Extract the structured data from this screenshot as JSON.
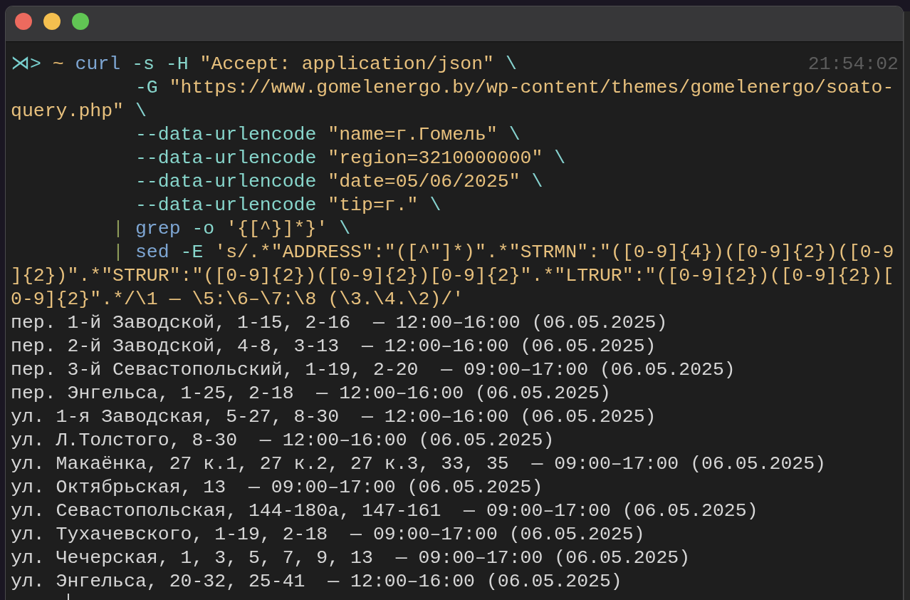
{
  "window": {
    "controls": [
      {
        "kind": "close"
      },
      {
        "kind": "minimize"
      },
      {
        "kind": "zoom"
      }
    ]
  },
  "terminal": {
    "command_lines": [
      {
        "kind": "first",
        "timestamp": "21:54:02",
        "segments": [
          {
            "kind": "prompt",
            "text": "⋊>"
          },
          {
            "kind": "path",
            "text": " ~"
          },
          {
            "kind": "command",
            "text": " curl"
          },
          {
            "kind": "flag",
            "text": " -s -H"
          },
          {
            "kind": "string",
            "text": " \"Accept: application/json\""
          },
          {
            "kind": "continuation",
            "text": " \\"
          }
        ]
      },
      {
        "kind": "argument",
        "segments": [
          {
            "kind": "flag",
            "text": "-G"
          },
          {
            "kind": "string",
            "text": " \"https://www.gomelenergo.by/wp-content/themes/gomelenergo/soato-"
          }
        ]
      },
      {
        "kind": "wrap",
        "segments": [
          {
            "kind": "string",
            "text": "query.php\""
          },
          {
            "kind": "continuation",
            "text": " \\"
          }
        ]
      },
      {
        "kind": "argument",
        "segments": [
          {
            "kind": "flag",
            "text": "--data-urlencode"
          },
          {
            "kind": "string",
            "text": " \"name=г.Гомель\""
          },
          {
            "kind": "continuation",
            "text": " \\"
          }
        ]
      },
      {
        "kind": "argument",
        "segments": [
          {
            "kind": "flag",
            "text": "--data-urlencode"
          },
          {
            "kind": "string",
            "text": " \"region=3210000000\""
          },
          {
            "kind": "continuation",
            "text": " \\"
          }
        ]
      },
      {
        "kind": "argument",
        "segments": [
          {
            "kind": "flag",
            "text": "--data-urlencode"
          },
          {
            "kind": "string",
            "text": " \"date=05/06/2025\""
          },
          {
            "kind": "continuation",
            "text": " \\"
          }
        ]
      },
      {
        "kind": "argument",
        "segments": [
          {
            "kind": "flag",
            "text": "--data-urlencode"
          },
          {
            "kind": "string",
            "text": " \"tip=г.\""
          },
          {
            "kind": "continuation",
            "text": " \\"
          }
        ]
      },
      {
        "kind": "pipe",
        "segments": [
          {
            "kind": "pipe",
            "text": "|"
          },
          {
            "kind": "command",
            "text": " grep"
          },
          {
            "kind": "flag",
            "text": " -o"
          },
          {
            "kind": "string",
            "text": " '{[^}]*}'"
          },
          {
            "kind": "continuation",
            "text": " \\"
          }
        ]
      },
      {
        "kind": "pipe",
        "segments": [
          {
            "kind": "pipe",
            "text": "|"
          },
          {
            "kind": "command",
            "text": " sed"
          },
          {
            "kind": "flag",
            "text": " -E"
          },
          {
            "kind": "string",
            "text": " 's/.*\"ADDRESS\":\"([^\"]*)\".*\"STRMN\":\"([0-9]{4})([0-9]{2})([0-9"
          }
        ]
      },
      {
        "kind": "wrap",
        "segments": [
          {
            "kind": "string",
            "text": "]{2})\".*\"STRUR\":\"([0-9]{2})([0-9]{2})[0-9]{2}\".*\"LTRUR\":\"([0-9]{2})([0-9]{2})["
          }
        ]
      },
      {
        "kind": "wrap",
        "segments": [
          {
            "kind": "string",
            "text": "0-9]{2}\".*/\\1 — \\5:\\6–\\7:\\8 (\\3.\\4.\\2)/'"
          }
        ]
      }
    ],
    "output_lines": [
      "пер. 1-й Заводской, 1-15, 2-16  — 12:00–16:00 (06.05.2025)",
      "пер. 2-й Заводской, 4-8, 3-13  — 12:00–16:00 (06.05.2025)",
      "пер. 3-й Севастопольский, 1-19, 2-20  — 09:00–17:00 (06.05.2025)",
      "пер. Энгельса, 1-25, 2-18  — 12:00–16:00 (06.05.2025)",
      "ул. 1-я Заводская, 5-27, 8-30  — 12:00–16:00 (06.05.2025)",
      "ул. Л.Толстого, 8-30  — 12:00–16:00 (06.05.2025)",
      "ул. Макаёнка, 27 к.1, 27 к.2, 27 к.3, 33, 35  — 09:00–17:00 (06.05.2025)",
      "ул. Октябрьская, 13  — 09:00–17:00 (06.05.2025)",
      "ул. Севастопольская, 144-180а, 147-161  — 09:00–17:00 (06.05.2025)",
      "ул. Тухачевского, 1-19, 2-18  — 09:00–17:00 (06.05.2025)",
      "ул. Чечерская, 1, 3, 5, 7, 9, 13  — 09:00–17:00 (06.05.2025)",
      "ул. Энгельса, 20-32, 25-41  — 12:00–16:00 (06.05.2025)"
    ],
    "cursor": true
  }
}
